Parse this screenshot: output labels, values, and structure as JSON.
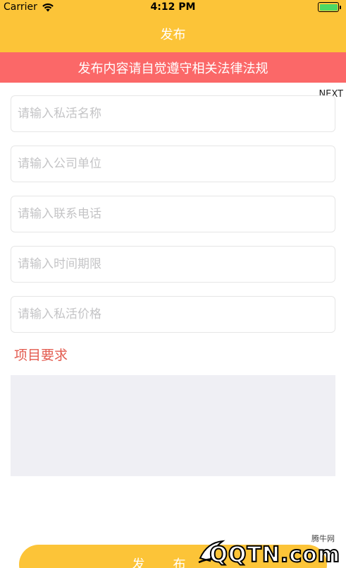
{
  "status_bar": {
    "carrier": "Carrier",
    "time": "4:12 PM",
    "battery_level": 1.0,
    "battery_color": "#4cd964"
  },
  "nav": {
    "title": "发布"
  },
  "notice": {
    "text": "发布内容请自觉遵守相关法律法规"
  },
  "keyboard_toolbar": {
    "next_label": "NEXT"
  },
  "form": {
    "fields": [
      {
        "placeholder": "请输入私活名称",
        "value": ""
      },
      {
        "placeholder": "请输入公司单位",
        "value": ""
      },
      {
        "placeholder": "请输入联系电话",
        "value": ""
      },
      {
        "placeholder": "请输入时间期限",
        "value": ""
      },
      {
        "placeholder": "请输入私活价格",
        "value": ""
      }
    ],
    "requirements_label": "项目要求",
    "requirements_value": ""
  },
  "submit": {
    "label": "发布"
  },
  "watermark": {
    "site_text": "腾牛网",
    "logo_text": "QQTN.com"
  },
  "colors": {
    "header": "#fcc438",
    "notice": "#fb6868",
    "label_red": "#e35b4f",
    "textarea_bg": "#efeff4"
  }
}
